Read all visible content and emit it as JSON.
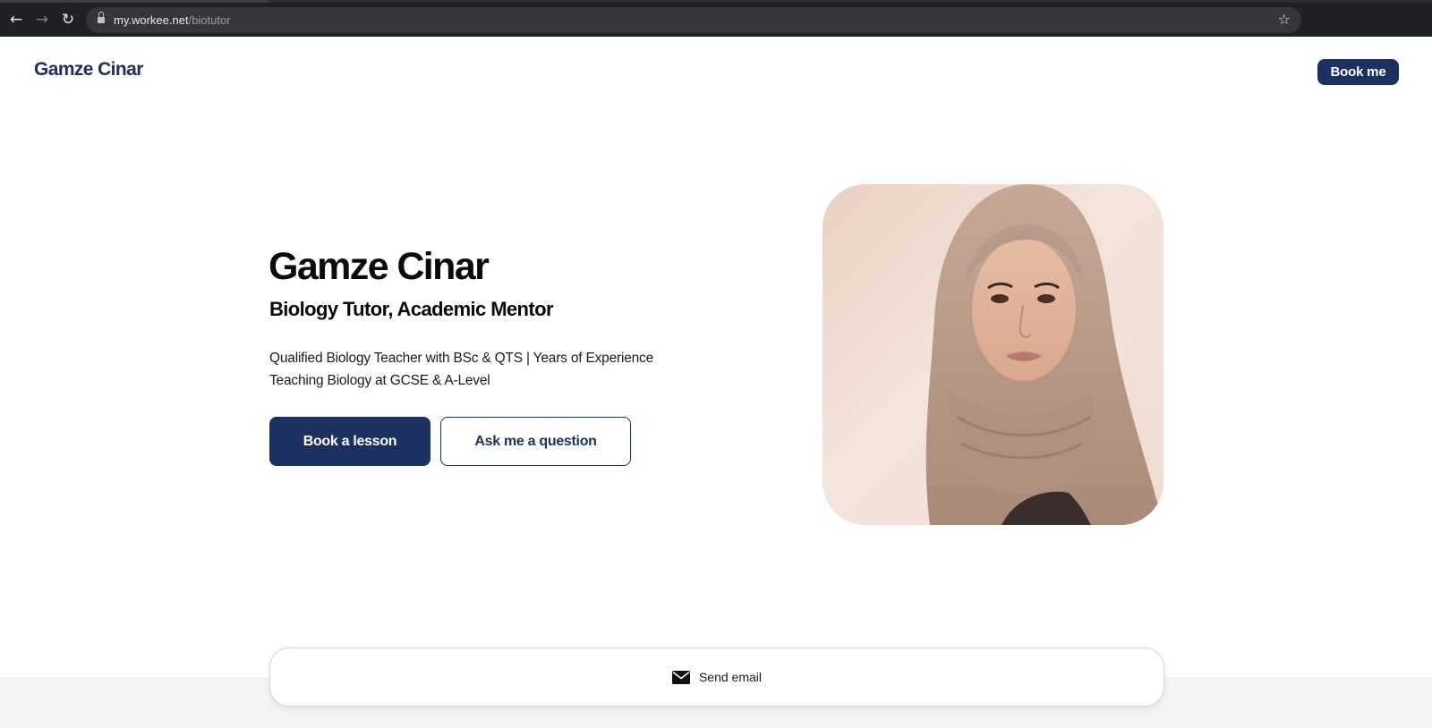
{
  "browser": {
    "url_host": "my.workee.net",
    "url_path": "/biotutor",
    "back_icon": "arrow-left-icon",
    "forward_icon": "arrow-right-icon",
    "reload_icon": "reload-icon",
    "bookmark_icon": "star-icon"
  },
  "header": {
    "logo_text": "Gamze Cinar",
    "book_me_label": "Book me"
  },
  "hero": {
    "name": "Gamze Cinar",
    "role": "Biology Tutor, Academic Mentor",
    "description": "Qualified Biology Teacher with BSc & QTS | Years of Experience Teaching Biology at GCSE & A-Level",
    "primary_button": "Book a lesson",
    "secondary_button": "Ask me a question"
  },
  "contact": {
    "send_email_label": "Send email",
    "icon": "mail-icon"
  },
  "colors": {
    "brand": "#1d3160",
    "text": "#0b0b0b",
    "footer_band": "#f4f4f4"
  }
}
